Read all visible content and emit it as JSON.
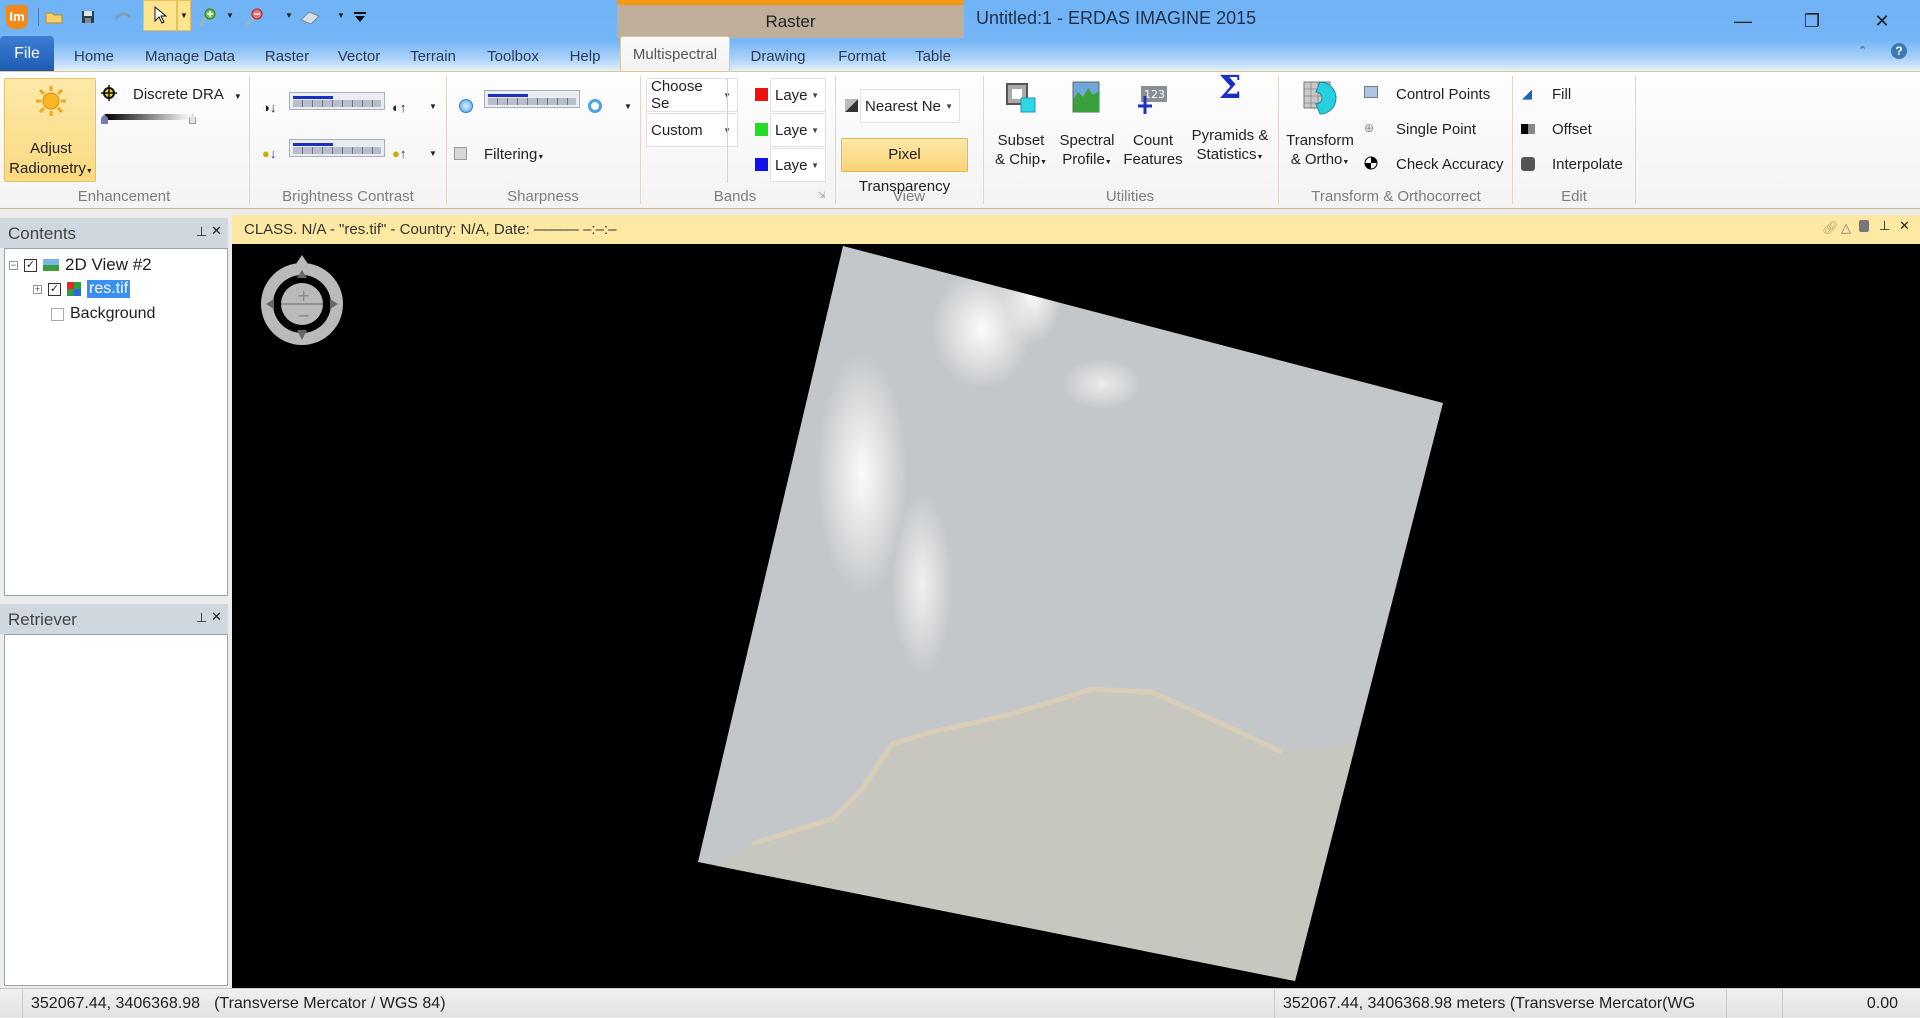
{
  "app": {
    "logo": "Im",
    "window_title": "Untitled:1 - ERDAS IMAGINE 2015",
    "context_tab_group": "Raster"
  },
  "quick_access": [
    {
      "icon": "open-folder-icon"
    },
    {
      "icon": "save-icon"
    },
    {
      "icon": "undo-icon"
    },
    {
      "icon": "select-pointer-icon"
    },
    {
      "icon": "zoom-in-icon"
    },
    {
      "icon": "zoom-out-icon"
    },
    {
      "icon": "eraser-icon"
    },
    {
      "icon": "customize-toolbar-icon"
    }
  ],
  "window_controls": {
    "minimize": "—",
    "restore": "❐",
    "close": "✕"
  },
  "tabs": [
    "File",
    "Home",
    "Manage Data",
    "Raster",
    "Vector",
    "Terrain",
    "Toolbox",
    "Help",
    "Multispectral",
    "Drawing",
    "Format",
    "Table"
  ],
  "active_tab": "Multispectral",
  "ribbon": {
    "enhancement": {
      "label": "Enhancement",
      "adjust_radiometry": [
        "Adjust",
        "Radiometry"
      ],
      "dra_mode": "Discrete DRA"
    },
    "brightness_contrast": {
      "label": "Brightness Contrast",
      "contrast_level": 0.45,
      "brightness_level": 0.45
    },
    "sharpness": {
      "label": "Sharpness",
      "sharpness_level": 0.45,
      "filtering": "Filtering"
    },
    "bands": {
      "label": "Bands",
      "sensor_select": "Choose Se",
      "band_combo": "Custom",
      "layers": [
        {
          "channel": "red",
          "color": "#ee1111",
          "value": "Laye"
        },
        {
          "channel": "green",
          "color": "#22dd22",
          "value": "Laye"
        },
        {
          "channel": "blue",
          "color": "#1111ee",
          "value": "Laye"
        }
      ]
    },
    "view": {
      "label": "View",
      "resample": "Nearest Ne",
      "pixel_transparency": "Pixel Transparency"
    },
    "utilities": {
      "label": "Utilities",
      "buttons": [
        [
          "Subset",
          "& Chip"
        ],
        [
          "Spectral",
          "Profile"
        ],
        [
          "Count",
          "Features"
        ],
        [
          "Pyramids &",
          "Statistics"
        ]
      ]
    },
    "transform": {
      "label": "Transform & Orthocorrect",
      "transform_ortho": [
        "Transform",
        "& Ortho"
      ],
      "items": [
        "Control Points",
        "Single Point",
        "Check Accuracy"
      ]
    },
    "edit": {
      "label": "Edit",
      "items": [
        "Fill",
        "Offset",
        "Interpolate"
      ]
    }
  },
  "contents_panel": {
    "title": "Contents",
    "tree": [
      {
        "label": "2D View #2",
        "checked": true
      },
      {
        "label": "res.tif",
        "checked": true,
        "selected": true
      },
      {
        "label": "Background",
        "checked": false
      }
    ]
  },
  "retriever_panel": {
    "title": "Retriever"
  },
  "viewer": {
    "header": "CLASS. N/A - \"res.tif\" - Country: N/A, Date: ——— –:–:–",
    "colors": {
      "background": "#000000",
      "ocean": "#c3c7ca",
      "land": "#c7c6bd",
      "cloud": "#f4f5f6"
    }
  },
  "status_bar": {
    "left_coords": "352067.44, 3406368.98",
    "left_projection": "(Transverse Mercator / WGS 84)",
    "right_coords": "352067.44, 3406368.98 meters (Transverse Mercator(WG",
    "value": "0.00"
  }
}
